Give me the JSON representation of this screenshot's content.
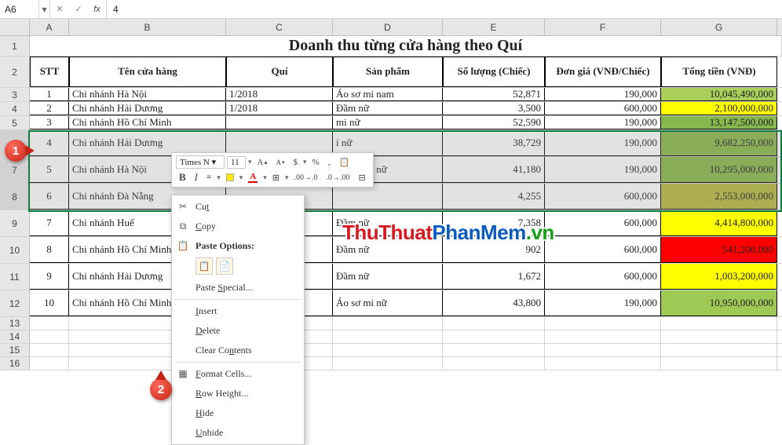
{
  "formula_bar": {
    "name_box": "A6",
    "cancel": "✕",
    "confirm": "✓",
    "fx": "fx",
    "value": "4"
  },
  "columns": [
    "A",
    "B",
    "C",
    "D",
    "E",
    "F",
    "G"
  ],
  "row_labels": [
    "1",
    "2",
    "3",
    "4",
    "5",
    "6",
    "7",
    "8",
    "9",
    "10",
    "11",
    "12",
    "13",
    "14",
    "15",
    "16"
  ],
  "title": "Doanh thu từng cửa hàng theo Quí",
  "headers": {
    "stt": "STT",
    "ten": "Tên cửa hàng",
    "qui": "Quí",
    "sp": "Sản phẩm",
    "sl": "Số lượng (Chiếc)",
    "dg": "Đơn giá (VNĐ/Chiếc)",
    "tt": "Tổng tiền (VNĐ)"
  },
  "rows": [
    {
      "stt": "1",
      "ten": "Chi nhánh Hà Nội",
      "qui": "1/2018",
      "sp": "Áo sơ mi nam",
      "sl": "52,871",
      "dg": "190,000",
      "tt": "10,045,490,000",
      "ttcls": "bg-green1"
    },
    {
      "stt": "2",
      "ten": "Chi nhánh Hải Dương",
      "qui": "1/2018",
      "sp": "Đầm nữ",
      "sl": "3,500",
      "dg": "600,000",
      "tt": "2,100,000,000",
      "ttcls": "bg-yellow"
    },
    {
      "stt": "3",
      "ten": "Chi nhánh Hồ Chí Minh",
      "qui": "",
      "sp": "mi nữ",
      "sl": "52,590",
      "dg": "190,000",
      "tt": "13,147,500,000",
      "ttcls": "bg-green2"
    },
    {
      "stt": "4",
      "ten": "Chi nhánh Hải Dương",
      "qui": "",
      "sp": "i nữ",
      "sl": "38,729",
      "dg": "190,000",
      "tt": "9,682,250,000",
      "ttcls": "bg-green3"
    },
    {
      "stt": "5",
      "ten": "Chi nhánh Hà Nội",
      "qui": "",
      "sp": "Áo sơ mi nữ",
      "sl": "41,180",
      "dg": "190,000",
      "tt": "10,295,000,000",
      "ttcls": "bg-green3"
    },
    {
      "stt": "6",
      "ten": "Chi nhánh Đà Nẵng",
      "qui": "",
      "sp": "",
      "sl": "4,255",
      "dg": "600,000",
      "tt": "2,553,000,000",
      "ttcls": "bg-olive"
    },
    {
      "stt": "7",
      "ten": "Chi nhánh Huế",
      "qui": "",
      "sp": "Đầm nữ",
      "sl": "7,358",
      "dg": "600,000",
      "tt": "4,414,800,000",
      "ttcls": "bg-yellow"
    },
    {
      "stt": "8",
      "ten": "Chi nhánh Hồ Chí Minh",
      "qui": "",
      "sp": "Đầm nữ",
      "sl": "902",
      "dg": "600,000",
      "tt": "541,200,000",
      "ttcls": "bg-red"
    },
    {
      "stt": "9",
      "ten": "Chi nhánh Hải Dương",
      "qui": "",
      "sp": "Đầm nữ",
      "sl": "1,672",
      "dg": "600,000",
      "tt": "1,003,200,000",
      "ttcls": "bg-yellow"
    },
    {
      "stt": "10",
      "ten": "Chi nhánh Hồ Chí Minh",
      "qui": "",
      "sp": "Áo sơ mi nữ",
      "sl": "43,800",
      "dg": "190,000",
      "tt": "10,950,000,000",
      "ttcls": "bg-green5"
    }
  ],
  "mini_toolbar": {
    "font": "Times N",
    "size": "11",
    "inc": "A",
    "dec": "A",
    "currency": "$",
    "percent": "%",
    "comma": ",",
    "b": "B",
    "i": "I",
    "a_color": "A"
  },
  "context_menu": {
    "cut": "Cut",
    "copy": "Copy",
    "paste_options": "Paste Options:",
    "paste_special": "Paste Special...",
    "insert": "Insert",
    "delete": "Delete",
    "clear": "Clear Contents",
    "format_cells": "Format Cells...",
    "row_height": "Row Height...",
    "hide": "Hide",
    "unhide": "Unhide"
  },
  "callouts": {
    "c1": "1",
    "c2": "2"
  },
  "watermark": {
    "p1": "ThuThuat",
    "p2": "PhanMem",
    "p3": ".vn"
  },
  "chart_data": {
    "type": "table",
    "title": "Doanh thu từng cửa hàng theo Quí",
    "columns": [
      "STT",
      "Tên cửa hàng",
      "Quí",
      "Sản phẩm",
      "Số lượng (Chiếc)",
      "Đơn giá (VNĐ/Chiếc)",
      "Tổng tiền (VNĐ)"
    ],
    "rows": [
      [
        1,
        "Chi nhánh Hà Nội",
        "1/2018",
        "Áo sơ mi nam",
        52871,
        190000,
        10045490000
      ],
      [
        2,
        "Chi nhánh Hải Dương",
        "1/2018",
        "Đầm nữ",
        3500,
        600000,
        2100000000
      ],
      [
        3,
        "Chi nhánh Hồ Chí Minh",
        null,
        null,
        52590,
        190000,
        13147500000
      ],
      [
        4,
        "Chi nhánh Hải Dương",
        null,
        null,
        38729,
        190000,
        9682250000
      ],
      [
        5,
        "Chi nhánh Hà Nội",
        null,
        "Áo sơ mi nữ",
        41180,
        190000,
        10295000000
      ],
      [
        6,
        "Chi nhánh Đà Nẵng",
        null,
        null,
        4255,
        600000,
        2553000000
      ],
      [
        7,
        "Chi nhánh Huế",
        null,
        "Đầm nữ",
        7358,
        600000,
        4414800000
      ],
      [
        8,
        "Chi nhánh Hồ Chí Minh",
        null,
        "Đầm nữ",
        902,
        600000,
        541200000
      ],
      [
        9,
        "Chi nhánh Hải Dương",
        null,
        "Đầm nữ",
        1672,
        600000,
        1003200000
      ],
      [
        10,
        "Chi nhánh Hồ Chí Minh",
        null,
        "Áo sơ mi nữ",
        43800,
        190000,
        10950000000
      ]
    ]
  }
}
